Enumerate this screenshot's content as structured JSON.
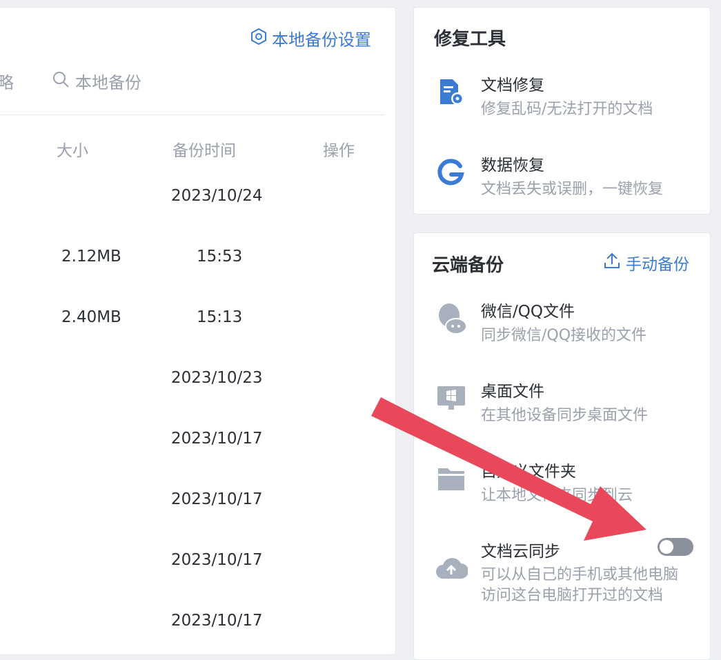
{
  "left": {
    "settings_label": "本地备份设置",
    "partial_char": "略",
    "search_placeholder": "本地备份",
    "columns": {
      "size": "大小",
      "time": "备份时间",
      "action": "操作"
    },
    "rows": [
      {
        "size": "",
        "time": "2023/10/24"
      },
      {
        "size": "2.12MB",
        "time": "15:53"
      },
      {
        "size": "2.40MB",
        "time": "15:13"
      },
      {
        "size": "",
        "time": "2023/10/23"
      },
      {
        "size": "",
        "time": "2023/10/17"
      },
      {
        "size": "",
        "time": "2023/10/17"
      },
      {
        "size": "",
        "time": "2023/10/17"
      },
      {
        "size": "",
        "time": "2023/10/17"
      }
    ]
  },
  "repair": {
    "title": "修复工具",
    "items": [
      {
        "title": "文档修复",
        "subtitle": "修复乱码/无法打开的文档",
        "icon": "doc-repair-icon"
      },
      {
        "title": "数据恢复",
        "subtitle": "文档丢失或误删，一键恢复",
        "icon": "data-recovery-icon"
      }
    ]
  },
  "cloud": {
    "title": "云端备份",
    "manual_backup": "手动备份",
    "items": [
      {
        "title": "微信/QQ文件",
        "subtitle": "同步微信/QQ接收的文件",
        "icon": "chat-icon"
      },
      {
        "title": "桌面文件",
        "subtitle": "在其他设备同步桌面文件",
        "icon": "desktop-icon"
      },
      {
        "title": "自定义文件夹",
        "subtitle": "让本地文件夹同步到云",
        "icon": "folder-icon"
      },
      {
        "title": "文档云同步",
        "subtitle_line1": "可以从自己的手机或其他电脑",
        "subtitle_line2": "访问这台电脑打开过的文档",
        "icon": "cloud-upload-icon",
        "enabled": false
      }
    ]
  },
  "colors": {
    "accent": "#3a7bd5",
    "arrow": "#e8485a",
    "toggle_off": "#8a909c"
  }
}
